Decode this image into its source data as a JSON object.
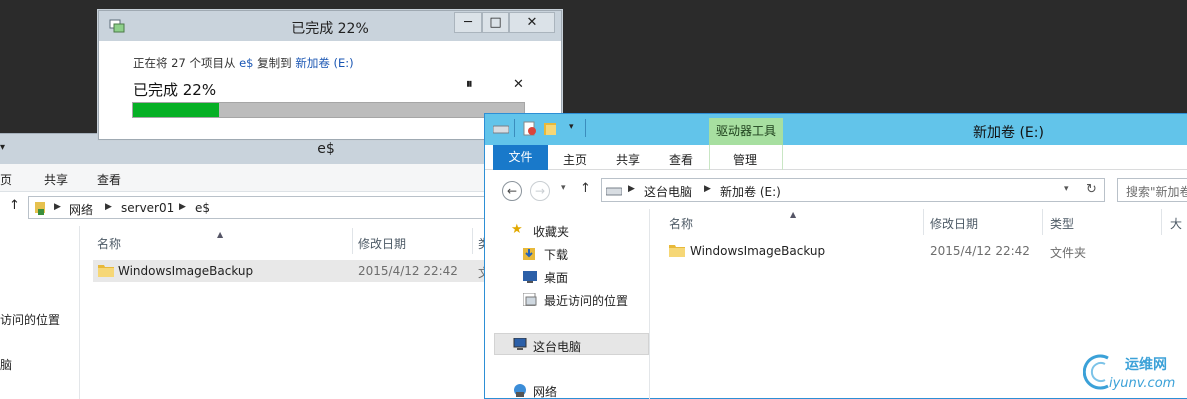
{
  "copy_dialog": {
    "title": "已完成 22%",
    "minimize": "─",
    "maximize": "□",
    "close": "✕",
    "description_prefix": "正在将 27 个项目从 ",
    "source": "e$",
    "description_middle": " 复制到 ",
    "destination": "新加卷 (E:)",
    "progress_text": "已完成 22%",
    "progress_fraction": 0.22,
    "pause_symbol": "⏸",
    "cancel_symbol": "✕"
  },
  "left_window": {
    "title": "e$",
    "ribbon_tabs": [
      "主页",
      "共享",
      "查看"
    ],
    "ribbon_tab_partial": "页",
    "breadcrumb": [
      "网络",
      "server01",
      "e$"
    ],
    "columns": [
      "名称",
      "修改日期",
      "类"
    ],
    "nav_items": [
      "访问的位置",
      "脑"
    ],
    "files": [
      {
        "name": "WindowsImageBackup",
        "modified": "2015/4/12 22:42",
        "type": "文"
      }
    ]
  },
  "right_window": {
    "title": "新加卷 (E:)",
    "contextual_tab_group": "驱动器工具",
    "ribbon_tabs": [
      "文件",
      "主页",
      "共享",
      "查看",
      "管理"
    ],
    "breadcrumb": [
      "这台电脑",
      "新加卷 (E:)"
    ],
    "search_placeholder": "搜索\"新加卷",
    "nav_items": [
      "收藏夹",
      "下载",
      "桌面",
      "最近访问的位置",
      "这台电脑",
      "网络"
    ],
    "columns": [
      "名称",
      "修改日期",
      "类型",
      "大"
    ],
    "files": [
      {
        "name": "WindowsImageBackup",
        "modified": "2015/4/12 22:42",
        "type": "文件夹"
      }
    ]
  },
  "watermark": {
    "cn": "运维网",
    "en": "iyunv.com"
  },
  "colors": {
    "progress_fill": "#06b025",
    "active_titlebar": "#62c4ea",
    "file_tab": "#1979ca",
    "contextual_group": "#a7dfa0"
  }
}
